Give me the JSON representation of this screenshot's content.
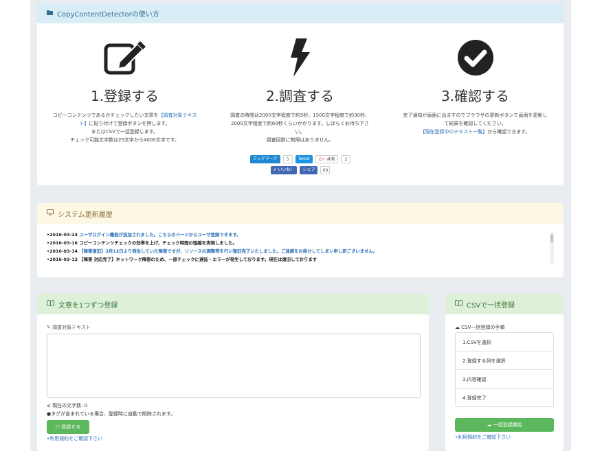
{
  "howto": {
    "title": "CopyContentDetectorの使い方",
    "steps": [
      {
        "icon": "edit-icon",
        "title": "1.登録する",
        "desc": "コピーコンテンツであるかチェックしたい文章を【調査対象テキスト】に貼り付けて登録ボタンを押します。\nまたはCSVで一括登録します。\nチェック可能文字数は25文字から4000文字です。"
      },
      {
        "icon": "bolt-icon",
        "title": "2.調査する",
        "desc": "調査の時間は2000文字程度で約5秒、1500文字程度で約30秒、2000文字程度で約60秒くらいかかります。しばらくお待ち下さい。\n調査回数に制限はありません。"
      },
      {
        "icon": "check-circle-icon",
        "title": "3.確認する",
        "desc": "完了通知が画面に出ますのでブラウザの更新ボタンで画面を更新して結果を確認してください。\n【現在登録中のテキスト一覧】から確認できます。"
      }
    ],
    "social": {
      "hatena_label": "ブックマーク",
      "hatena_count": "3",
      "tweet_label": "Tweet",
      "gplus_label": "共有",
      "gplus_count": "2",
      "like_label": "いいね！",
      "share_label": "シェア",
      "share_count": "69"
    }
  },
  "updates": {
    "title": "システム更新履歴",
    "items": [
      {
        "date": "•2016-03-24",
        "text": "ユーザログイン機能が追加されました。こちらのページからユーザ登録できます。",
        "style": "blue"
      },
      {
        "date": "•2016-03-16",
        "text": "コピーコンテンツチェックの効率を上げ、チェック時間の短縮を実現しました。",
        "style": "dark"
      },
      {
        "date": "•2016-03-14",
        "text": "【障害復旧】3月12日より発生していた障害ですが、リソースの調整等を行い復旧完了いたしました。ご迷惑をお掛けしてしまい申し訳ございません。",
        "style": "blue"
      },
      {
        "date": "•2016-03-12",
        "text": "【障害 対応完了】ネットワーク障害のため、一部チェックに遅延・エラーが発生しております。現在は復旧しております",
        "style": "dark"
      }
    ]
  },
  "single": {
    "title": "文章を1つずつ登録",
    "field_label": "調査対象テキスト",
    "char_count": "現在の文字数: 0",
    "tag_note": "●タグが含まれている場合、登録時に自動で削除されます。",
    "register_button": "登録する",
    "terms_link": "•利用規約をご確認下さい"
  },
  "csv": {
    "title": "CSVで一括登録",
    "steps_label": "CSV一括登録の手順",
    "steps": [
      "1.CSVを選択",
      "2.登録する列を選択",
      "3.内容確認",
      "4.登録完了"
    ],
    "button": "一括登録開始",
    "terms_link": "•利用規約をご確認下さい"
  },
  "colors": {
    "info_header": "#d9edf7",
    "warning_header": "#fcf8e3",
    "success_header": "#dff0d8",
    "success_button": "#5cb85c",
    "link": "#2a6fb6"
  }
}
